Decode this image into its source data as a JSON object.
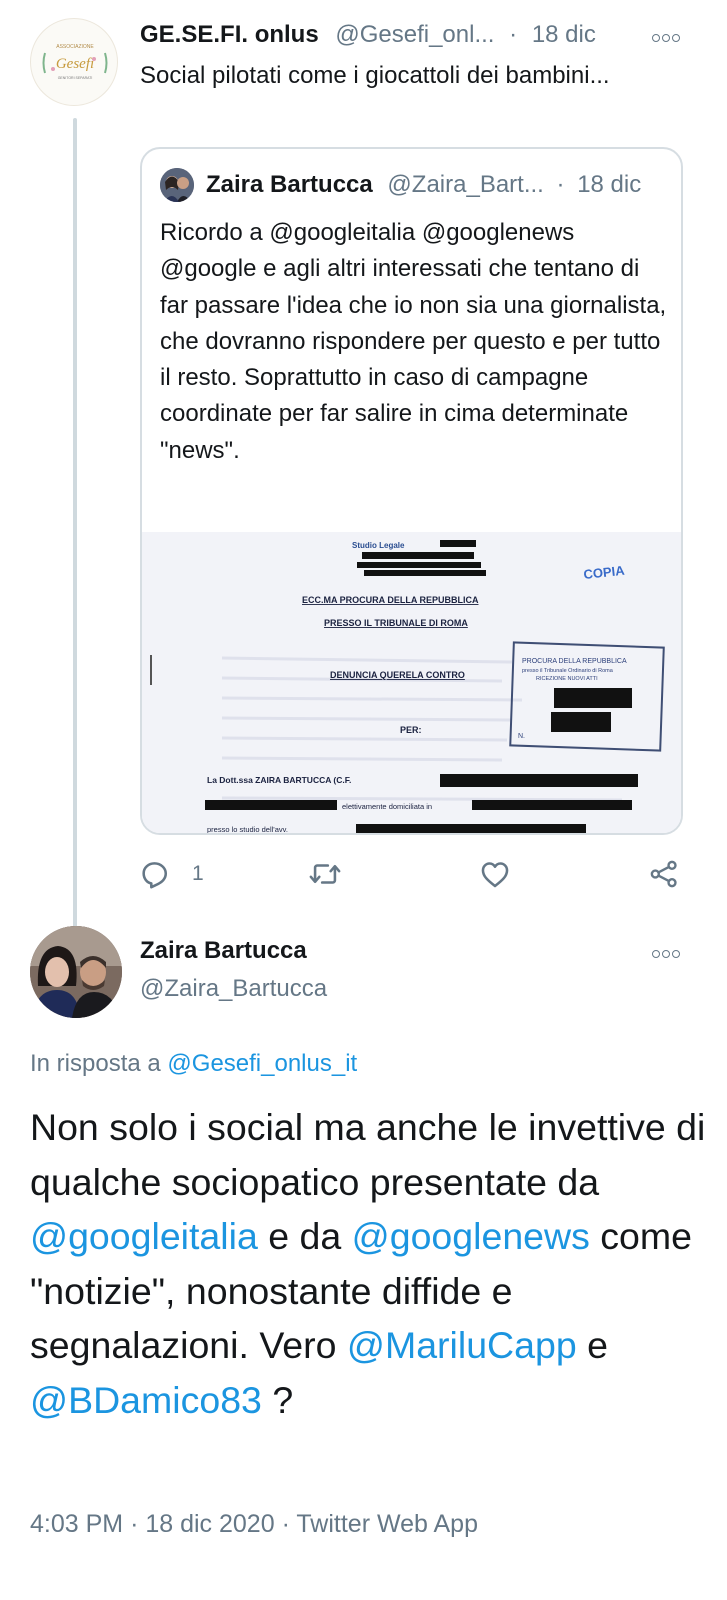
{
  "tweet_1": {
    "display_name": "GE.SE.FI. onlus",
    "handle": "@Gesefi_onl...",
    "separator": "·",
    "date": "18 dic",
    "avatar_logo_text": "Associazione Gesefi",
    "text": "Social pilotati come i giocattoli dei bambini...",
    "quoted_tweet": {
      "display_name": "Zaira Bartucca",
      "handle": "@Zaira_Bart...",
      "separator": "·",
      "date": "18 dic",
      "text": "Ricordo a @googleitalia @googlenews @google e agli altri interessati che tentano di far passare l'idea che io non sia una giornalista, che dovranno rispondere per questo e per tutto il resto. Soprattutto in caso di campagne coordinate per far salire in cima determinate \"news\".",
      "image": {
        "letterhead": "Studio Legale",
        "copy_stamp": "COPIA",
        "addressee_1": "ECC.MA PROCURA DELLA REPUBBLICA",
        "addressee_2": "PRESSO IL TRIBUNALE DI ROMA",
        "subject": "DENUNCIA QUERELA CONTRO",
        "per": "PER:",
        "stamp_line_1": "PROCURA DELLA REPUBBLICA",
        "stamp_line_2": "presso il Tribunale Ordinario di Roma",
        "stamp_line_3": "RICEZIONE NUOVI ATTI",
        "stamp_n": "N.",
        "line_1": "La Dott.ssa  ZAIRA BARTUCCA (C.F.",
        "line_2": "elettivamente domiciliata in",
        "line_3": "presso lo studio dell'avv."
      }
    },
    "actions": {
      "reply_count": "1",
      "retweet_count": "",
      "like_count": ""
    }
  },
  "tweet_2": {
    "display_name": "Zaira Bartucca",
    "handle": "@Zaira_Bartucca",
    "reply_to_prefix": "In risposta a",
    "reply_to_handle": "@Gesefi_onlus_it",
    "body_segments": [
      {
        "text": "Non solo i social ma anche le invettive di qualche sociopatico presentate da ",
        "link": false
      },
      {
        "text": "@googleitalia",
        "link": true
      },
      {
        "text": " e da ",
        "link": false
      },
      {
        "text": "@googlenews",
        "link": true
      },
      {
        "text": " come \"notizie\", nonostante diffide e segnalazioni. Vero ",
        "link": false
      },
      {
        "text": "@MariluCapp",
        "link": true
      },
      {
        "text": " e ",
        "link": false
      },
      {
        "text": "@BDamico83",
        "link": true
      },
      {
        "text": " ?",
        "link": false
      }
    ],
    "time": "4:03 PM",
    "separator": "·",
    "date": "18 dic 2020",
    "source": "Twitter Web App"
  },
  "colors": {
    "text_primary": "#14171a",
    "text_muted": "#657786",
    "link": "#1b95e0",
    "border": "#d6dde2",
    "thread_line": "#cfd9de"
  },
  "icons": [
    "more-options-icon",
    "reply-icon",
    "retweet-icon",
    "like-icon",
    "share-icon"
  ]
}
